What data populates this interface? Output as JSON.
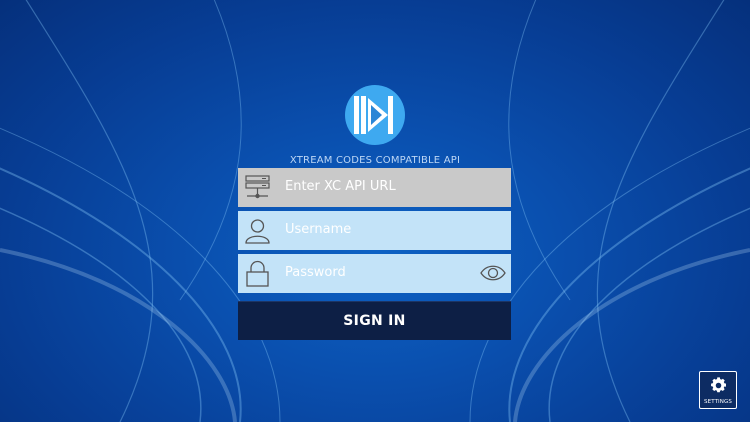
{
  "app": {
    "logo_icon": "xtream-play-logo",
    "subtitle": "XTREAM CODES COMPATIBLE API"
  },
  "form": {
    "url": {
      "placeholder": "Enter XC API URL",
      "value": "",
      "icon": "server-icon"
    },
    "username": {
      "placeholder": "Username",
      "value": "",
      "icon": "user-icon"
    },
    "password": {
      "placeholder": "Password",
      "value": "",
      "icon": "lock-icon",
      "toggle_icon": "eye-icon"
    },
    "sign_in_label": "SIGN IN"
  },
  "settings": {
    "label": "SETTINGS",
    "icon": "gear-icon"
  },
  "colors": {
    "background": "#0a4fae",
    "field_active": "#c3e3f8",
    "field_disabled": "#c9c9c9",
    "button": "#0d1f45",
    "logo": "#3ea9f0"
  }
}
